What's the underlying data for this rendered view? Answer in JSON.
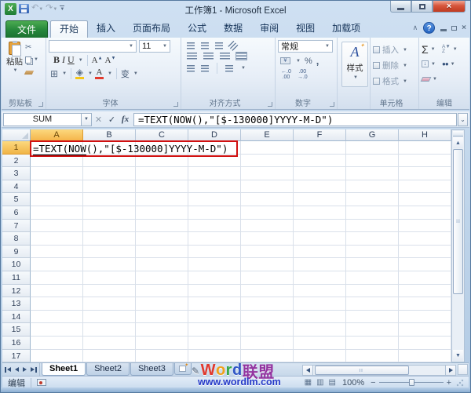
{
  "window": {
    "title": "工作簿1 - Microsoft Excel"
  },
  "ribbon": {
    "file_tab": "文件",
    "tabs": [
      {
        "label": "开始",
        "name": "home",
        "active": true
      },
      {
        "label": "插入",
        "name": "insert"
      },
      {
        "label": "页面布局",
        "name": "page-layout"
      },
      {
        "label": "公式",
        "name": "formulas"
      },
      {
        "label": "数据",
        "name": "data"
      },
      {
        "label": "审阅",
        "name": "review"
      },
      {
        "label": "视图",
        "name": "view"
      },
      {
        "label": "加载项",
        "name": "add-ins"
      }
    ],
    "groups": {
      "clipboard": {
        "label": "剪贴板",
        "paste": "粘贴"
      },
      "font": {
        "label": "字体",
        "size": "11",
        "bold": "B",
        "italic": "I",
        "underline": "U",
        "phonetic": "变"
      },
      "alignment": {
        "label": "对齐方式"
      },
      "number": {
        "label": "数字",
        "format": "常规",
        "currency": "¥",
        "percent": "%",
        "comma": ",",
        "decimal_increase": "←.0\n.00",
        "decimal_decrease": ".00\n→.0"
      },
      "style": {
        "label": "样式",
        "button": "样式"
      },
      "cells": {
        "label": "单元格",
        "items": [
          {
            "label": "插入"
          },
          {
            "label": "删除"
          },
          {
            "label": "格式"
          }
        ]
      },
      "editing": {
        "label": "编辑",
        "autosum": "Σ"
      }
    }
  },
  "formula_bar": {
    "name_box": "SUM",
    "cancel_icon": "✕",
    "enter_icon": "✓",
    "insert_function_icon": "fx",
    "formula": "=TEXT(NOW(),\"[$-130000]YYYY-M-D\")"
  },
  "grid": {
    "columns": [
      "A",
      "B",
      "C",
      "D",
      "E",
      "F",
      "G",
      "H"
    ],
    "row_count": 17,
    "selected_column": "A",
    "selected_row": "1",
    "a1_underlined": "=TEXT(NOW",
    "a1_rest": "(),\"[$-130000]YYYY-M-D\")"
  },
  "sheet_bar": {
    "tabs": [
      {
        "label": "Sheet1",
        "active": true
      },
      {
        "label": "Sheet2"
      },
      {
        "label": "Sheet3"
      }
    ]
  },
  "watermark": {
    "logo": [
      [
        "W",
        "#e0392e"
      ],
      [
        "o",
        "#f0a11c"
      ],
      [
        "r",
        "#35a844"
      ],
      [
        "d",
        "#3156c6"
      ],
      [
        "联",
        "#9334a0"
      ],
      [
        "盟",
        "#9334a0"
      ]
    ],
    "url": "www.wordlm.com"
  },
  "status_bar": {
    "mode": "编辑",
    "zoom_level": "100%"
  }
}
